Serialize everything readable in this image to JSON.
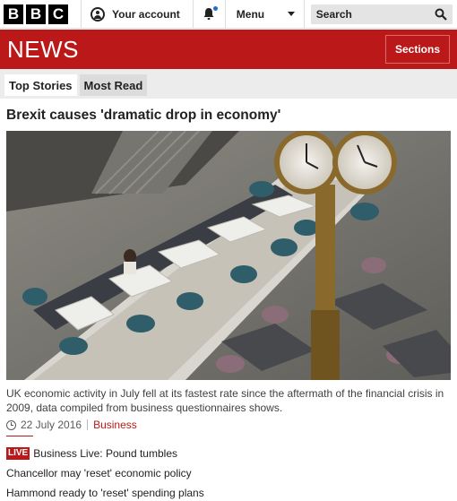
{
  "brand": {
    "letters": [
      "B",
      "B",
      "C"
    ],
    "section": "NEWS"
  },
  "topbar": {
    "account_label": "Your account",
    "menu_label": "Menu",
    "search_placeholder": "Search"
  },
  "header": {
    "sections_label": "Sections"
  },
  "tabs": [
    {
      "label": "Top Stories",
      "active": true
    },
    {
      "label": "Most Read",
      "active": false
    }
  ],
  "story": {
    "headline": "Brexit causes 'dramatic drop in economy'",
    "summary": "UK economic activity in July fell at its fastest rate since the aftermath of the financial crisis in 2009, data compiled from business questionnaires shows.",
    "date": "22 July 2016",
    "category": "Business"
  },
  "related": [
    {
      "badge": "LIVE",
      "text": "Business Live: Pound tumbles"
    },
    {
      "text": "Chancellor may 'reset' economic policy"
    },
    {
      "text": "Hammond ready to 'reset' spending plans"
    }
  ],
  "colors": {
    "brand_red": "#bb1919",
    "notification_blue": "#1f6cd3"
  }
}
